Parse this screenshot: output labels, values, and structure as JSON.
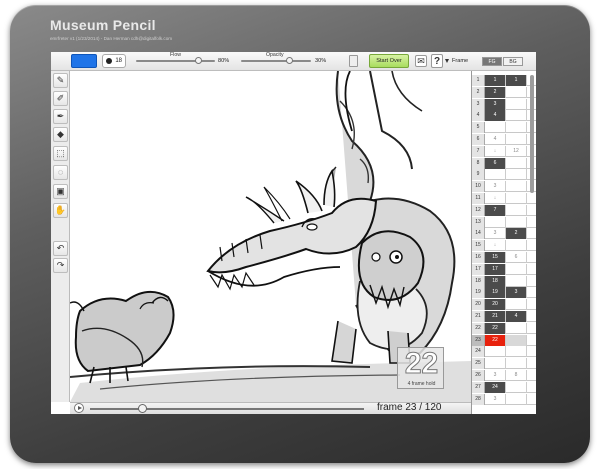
{
  "app": {
    "title": "Museum Pencil",
    "subtitle": "emrfreter v1 (1/23/2014) - Dan Herman cdh@digitalfolk.com"
  },
  "toolbar": {
    "brush_color": "#1f74e8",
    "brush_size": "18",
    "flow": {
      "label": "Flow",
      "value_label": "80%",
      "level": 0.8
    },
    "opacity": {
      "label": "Opacity",
      "value_label": "30%",
      "level": 0.7
    },
    "copy_icon": "copy-icon",
    "start_over_label": "Start Over",
    "mail_icon": "✉",
    "help_icon": "?"
  },
  "timeline_header": {
    "frame_label": "Frame",
    "fg_tab": "FG",
    "bg_tab": "BG"
  },
  "tools": [
    {
      "name": "pencil-tool",
      "glyph": "✎"
    },
    {
      "name": "marker-tool",
      "glyph": "✐"
    },
    {
      "name": "brush-tool",
      "glyph": "✒"
    },
    {
      "name": "eraser-tool",
      "glyph": "◆"
    },
    {
      "name": "select-rect-tool",
      "glyph": "⬚"
    },
    {
      "name": "lasso-tool",
      "glyph": "◌"
    },
    {
      "name": "frame-tool",
      "glyph": "▣"
    },
    {
      "name": "hand-tool",
      "glyph": "✋"
    },
    {
      "name": "undo-tool",
      "glyph": "↶"
    },
    {
      "name": "redo-tool",
      "glyph": "↷"
    }
  ],
  "hold": {
    "number": "22",
    "label": "4 frame hold"
  },
  "playback": {
    "frame_text": "frame 23 / 120",
    "current": 23,
    "total": 120,
    "progress": 0.19
  },
  "timeline_rows": [
    {
      "n": "1",
      "fg": "1",
      "fgk": true,
      "bg": "1",
      "bgk": true
    },
    {
      "n": "2",
      "fg": "2",
      "fgk": true,
      "bg": "",
      "bgk": false
    },
    {
      "n": "3",
      "fg": "3",
      "fgk": true,
      "bg": "",
      "bgk": false
    },
    {
      "n": "4",
      "fg": "4",
      "fgk": true,
      "bg": "",
      "bgk": false
    },
    {
      "n": "5",
      "fg": "",
      "fgk": false,
      "bg": "",
      "bgk": false
    },
    {
      "n": "6",
      "fg": "4",
      "fgk": false,
      "bg": "",
      "bgk": false
    },
    {
      "n": "7",
      "fg": "↓",
      "fgk": false,
      "bg": "12",
      "bgk": false
    },
    {
      "n": "8",
      "fg": "6",
      "fgk": true,
      "bg": "",
      "bgk": false
    },
    {
      "n": "9",
      "fg": "",
      "fgk": false,
      "bg": "",
      "bgk": false
    },
    {
      "n": "10",
      "fg": "3",
      "fgk": false,
      "bg": "",
      "bgk": false
    },
    {
      "n": "11",
      "fg": "↓",
      "fgk": false,
      "bg": "",
      "bgk": false
    },
    {
      "n": "12",
      "fg": "7",
      "fgk": true,
      "bg": "",
      "bgk": false
    },
    {
      "n": "13",
      "fg": "",
      "fgk": false,
      "bg": "",
      "bgk": false
    },
    {
      "n": "14",
      "fg": "3",
      "fgk": false,
      "bg": "2",
      "bgk": true
    },
    {
      "n": "15",
      "fg": "↓",
      "fgk": false,
      "bg": "",
      "bgk": false
    },
    {
      "n": "16",
      "fg": "15",
      "fgk": true,
      "bg": "6",
      "bgk": false
    },
    {
      "n": "17",
      "fg": "17",
      "fgk": true,
      "bg": "",
      "bgk": false
    },
    {
      "n": "18",
      "fg": "18",
      "fgk": true,
      "bg": "",
      "bgk": false
    },
    {
      "n": "19",
      "fg": "19",
      "fgk": true,
      "bg": "3",
      "bgk": true
    },
    {
      "n": "20",
      "fg": "20",
      "fgk": true,
      "bg": "",
      "bgk": false
    },
    {
      "n": "21",
      "fg": "21",
      "fgk": true,
      "bg": "4",
      "bgk": true
    },
    {
      "n": "22",
      "fg": "22",
      "fgk": true,
      "bg": "",
      "bgk": false
    },
    {
      "n": "23",
      "fg": "22",
      "fgk": false,
      "cur": true,
      "bg": "",
      "bgk": false
    },
    {
      "n": "24",
      "fg": "",
      "fgk": false,
      "bg": "",
      "bgk": false
    },
    {
      "n": "25",
      "fg": "",
      "fgk": false,
      "bg": "",
      "bgk": false
    },
    {
      "n": "26",
      "fg": "3",
      "fgk": false,
      "bg": "8",
      "bgk": false
    },
    {
      "n": "27",
      "fg": "24",
      "fgk": true,
      "bg": "",
      "bgk": false
    },
    {
      "n": "28",
      "fg": "3",
      "fgk": false,
      "bg": "",
      "bgk": false
    }
  ]
}
